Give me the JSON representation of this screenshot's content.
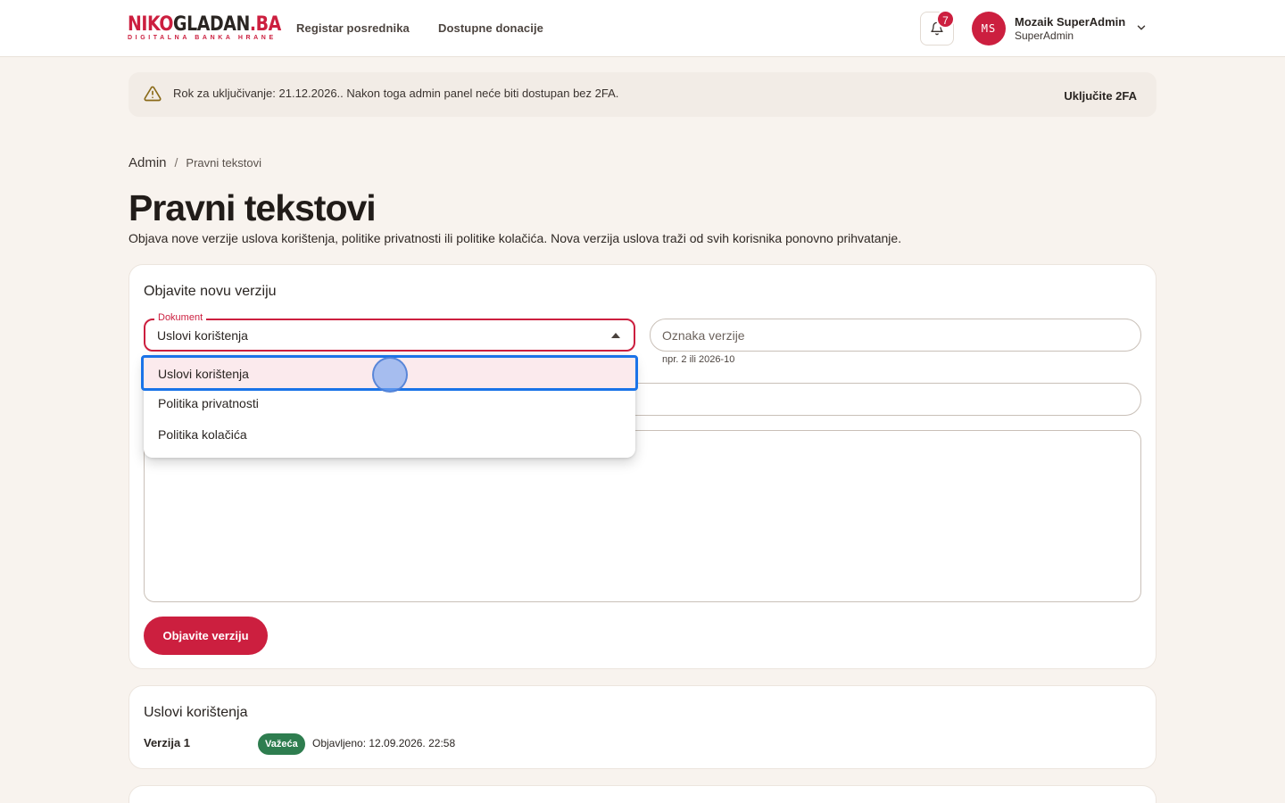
{
  "header": {
    "logo_red": "NIKO",
    "logo_dark": "GLADAN",
    "logo_suffix": ".BA",
    "logo_tagline": "DIGITALNA BANKA HRANE",
    "nav": [
      "Registar posrednika",
      "Dostupne donacije"
    ],
    "notifications_count": "7",
    "user_initials": "MS",
    "user_name": "Mozaik SuperAdmin",
    "user_role": "SuperAdmin"
  },
  "alert": {
    "text": "Rok za uključivanje: 21.12.2026.. Nakon toga admin panel neće biti dostupan bez 2FA.",
    "action": "Uključite 2FA"
  },
  "breadcrumb": {
    "root": "Admin",
    "separator": "/",
    "current": "Pravni tekstovi"
  },
  "page": {
    "title": "Pravni tekstovi",
    "subtitle": "Objava nove verzije uslova korištenja, politike privatnosti ili politike kolačića. Nova verzija uslova traži od svih korisnika ponovno prihvatanje."
  },
  "form": {
    "title": "Objavite novu verziju",
    "document_label": "Dokument",
    "document_value": "Uslovi korištenja",
    "document_options": [
      "Uslovi korištenja",
      "Politika privatnosti",
      "Politika kolačića"
    ],
    "version_placeholder": "Oznaka verzije",
    "version_hint": "npr. 2 ili 2026-10",
    "publish_button": "Objavite verziju"
  },
  "versions": {
    "title": "Uslovi korištenja",
    "items": [
      {
        "label": "Verzija 1",
        "status": "Važeća",
        "published": "Objavljeno: 12.09.2026. 22:58"
      }
    ]
  },
  "colors": {
    "brand": "#cc1f3f",
    "success": "#2e7d4f",
    "focus": "#1a73e8",
    "background": "#f8f3ee"
  }
}
